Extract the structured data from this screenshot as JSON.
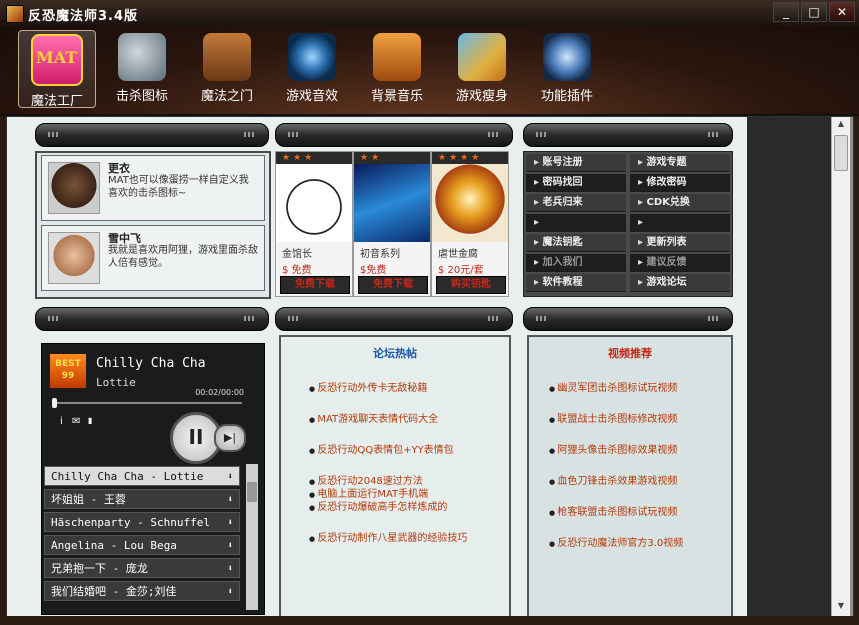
{
  "window": {
    "title": "反恐魔法师3.4版",
    "controls": [
      "_",
      "□",
      "✕"
    ]
  },
  "toolbar": {
    "items": [
      {
        "label": "魔法工厂",
        "icon": "mat-logo-icon",
        "active": true
      },
      {
        "label": "击杀图标",
        "icon": "kill-shield-icon",
        "active": false
      },
      {
        "label": "魔法之门",
        "icon": "magic-door-icon",
        "active": false
      },
      {
        "label": "游戏音效",
        "icon": "sound-disc-icon",
        "active": false
      },
      {
        "label": "背景音乐",
        "icon": "music-player-icon",
        "active": false
      },
      {
        "label": "游戏瘦身",
        "icon": "broom-icon",
        "active": false
      },
      {
        "label": "功能插件",
        "icon": "plugin-icon",
        "active": false
      }
    ],
    "mat_logo_text": "MAT"
  },
  "users": [
    {
      "name": "更衣",
      "text": "MAT也可以像蛋捞一样自定义我喜欢的击杀图标~"
    },
    {
      "name": "雪中飞",
      "text": "我就是喜欢用阿狸，游戏里面杀敌人倍有感觉。"
    }
  ],
  "skins": [
    {
      "stars": "★★★",
      "name": "金馆长",
      "price": "$ 免费",
      "button": "免费下载"
    },
    {
      "stars": "★★",
      "name": "初音系列",
      "price": "$免费",
      "button": "免费下载"
    },
    {
      "stars": "★★★★",
      "name": "虐世金腐",
      "price": "$ 20元/套",
      "button": "购买钥匙"
    }
  ],
  "links": [
    [
      "账号注册",
      "游戏专题"
    ],
    [
      "密码找回",
      "修改密码"
    ],
    [
      "老兵归来",
      "CDK兑换"
    ],
    [
      "",
      ""
    ],
    [
      "魔法钥匙",
      "更新列表"
    ],
    [
      "加入我们",
      "建议反馈"
    ],
    [
      "软件教程",
      "游戏论坛"
    ]
  ],
  "player": {
    "cover_text": "BEST 99",
    "title": "Chilly Cha Cha",
    "artist": "Lottie",
    "time": "00:02/00:00",
    "progress": 0.01,
    "play_symbol": "II",
    "next_symbol": "▶|",
    "info_symbol": "i",
    "mail_symbol": "✉",
    "bars_symbol": "▮",
    "playlist": [
      "Chilly Cha Cha - Lottie",
      "坏姐姐 - 王蓉",
      "Häschenparty - Schnuffel",
      "Angelina - Lou Bega",
      "兄弟抱一下 - 庞龙",
      "我们结婚吧 - 金莎;刘佳"
    ]
  },
  "forum": {
    "title": "论坛热帖",
    "items": [
      "反恐行动外传卡无敌秘籍",
      "MAT游戏聊天表情代码大全",
      "反恐行动QQ表情包+YY表情包",
      "反恐行动2048速过方法",
      "电脑上面运行MAT手机端",
      "反恐行动爆破高手怎样炼成的",
      "反恐行动制作八星武器的经验技巧"
    ]
  },
  "video": {
    "title": "视频推荐",
    "items": [
      "幽灵军团击杀图标试玩视频",
      "联盟战士击杀图标修改视频",
      "阿狸头像击杀图标效果视频",
      "血色刀锋击杀效果游戏视频",
      "枪客联盟击杀图标试玩视频",
      "反恐行动魔法师官方3.0视频"
    ]
  },
  "colors": {
    "accent_red": "#c0281a",
    "forum_blue": "#1a5aa8",
    "star_orange": "#e96a1a"
  }
}
